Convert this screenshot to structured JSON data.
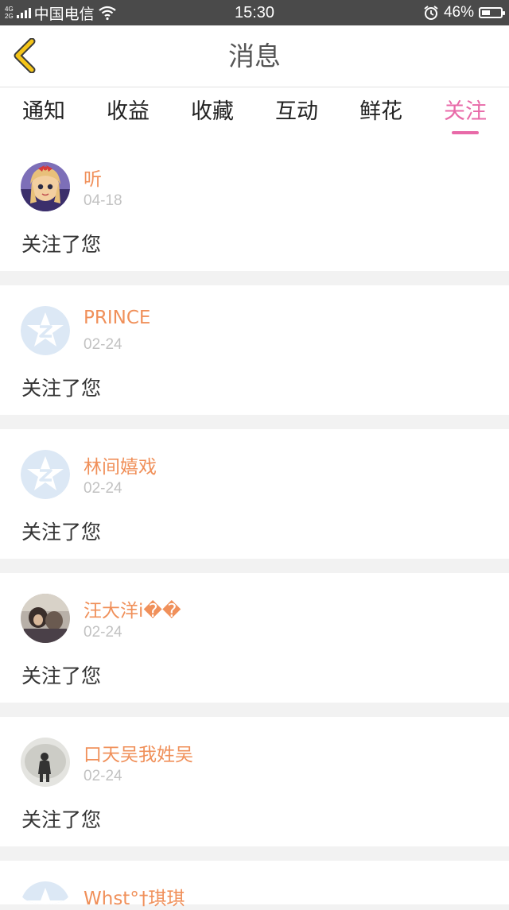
{
  "status_bar": {
    "network_top": "4G",
    "network_bottom": "2G",
    "carrier": "中国电信",
    "time": "15:30",
    "battery": "46%",
    "battery_level": 0.46
  },
  "header": {
    "title": "消息"
  },
  "tabs": [
    {
      "label": "通知",
      "active": false
    },
    {
      "label": "收益",
      "active": false
    },
    {
      "label": "收藏",
      "active": false
    },
    {
      "label": "互动",
      "active": false
    },
    {
      "label": "鲜花",
      "active": false
    },
    {
      "label": "关注",
      "active": true
    }
  ],
  "notifications": [
    {
      "name": "听",
      "date": "04-18",
      "message": "关注了您",
      "avatar": "anime-girl-avatar"
    },
    {
      "name": "PRINCE",
      "date": "02-24",
      "message": "关注了您",
      "avatar": "default-qzone-avatar"
    },
    {
      "name": "林间嬉戏",
      "date": "02-24",
      "message": "关注了您",
      "avatar": "default-qzone-avatar"
    },
    {
      "name": "汪大洋i��",
      "date": "02-24",
      "message": "关注了您",
      "avatar": "photo-avatar"
    },
    {
      "name": "口天吴我姓吴",
      "date": "02-24",
      "message": "关注了您",
      "avatar": "photo-avatar-grey"
    },
    {
      "name": "Whst°†琪琪",
      "date": "",
      "message": "",
      "avatar": "default-qzone-avatar"
    }
  ],
  "colors": {
    "accent": "#e86aa8",
    "name": "#f0905a",
    "back_arrow": "#f5c518"
  }
}
